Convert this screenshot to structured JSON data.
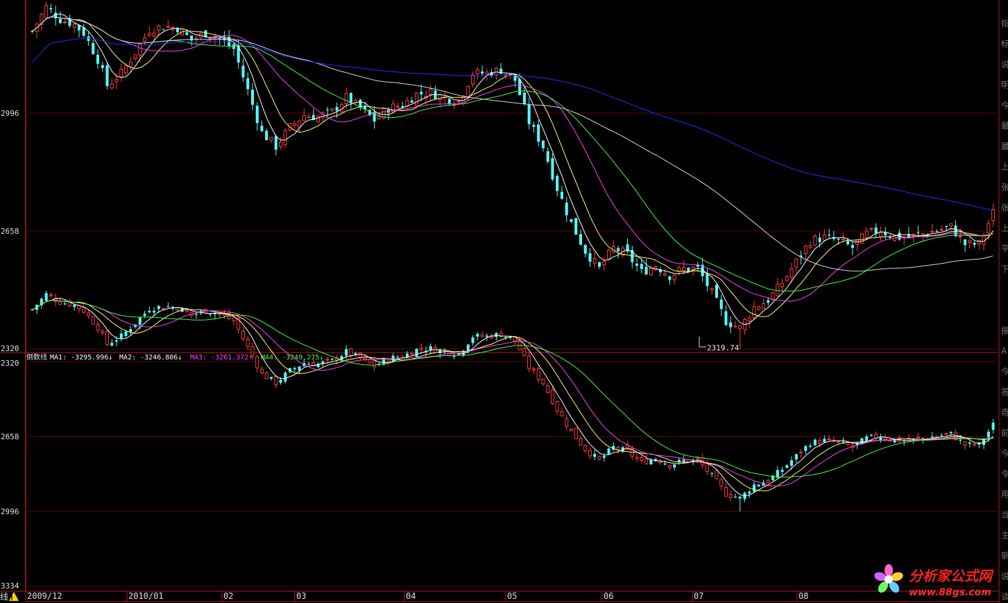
{
  "colors": {
    "background": "#000000",
    "frame": "#c01818",
    "up_candle": "#ff3d3d",
    "down_candle": "#54ffff",
    "ma_white": "#ffffff",
    "ma_yellow": "#ffff80",
    "ma_magenta": "#ff40ff",
    "ma_green": "#40ff40",
    "ma_blue": "#2030ff",
    "ma_gray": "#d8d8d8"
  },
  "top_panel": {
    "y_labels": [
      "2996",
      "2658",
      "2320"
    ],
    "low_marker": "2319.74"
  },
  "bottom_panel": {
    "indicator_name": "倒数线",
    "legend": [
      {
        "name": "MA1",
        "value": "-3295.996",
        "arrow": "↓",
        "color": "#ffffff"
      },
      {
        "name": "MA2",
        "value": "-3246.806",
        "arrow": "↓",
        "color": "#ffffff"
      },
      {
        "name": "MA3",
        "value": "-3261.372",
        "arrow": "↑",
        "color": "#ff40ff"
      },
      {
        "name": "MA4",
        "value": "-3249.275",
        "arrow": "↓",
        "color": "#40ff40"
      }
    ],
    "y_labels": [
      "2320",
      "2658",
      "2996",
      "3334"
    ]
  },
  "x_axis": {
    "corner_label": "线",
    "months": [
      "2009/12",
      "2010/01",
      "02",
      "03",
      "04",
      "05",
      "06",
      "07",
      "08"
    ]
  },
  "right_sidebar": {
    "chars": [
      "指",
      "标",
      "说",
      "明",
      "今",
      "最",
      "最",
      "上",
      "张",
      "张",
      "上",
      "平",
      "下",
      "",
      "",
      "振",
      "A",
      "今",
      "答",
      "奇",
      "前",
      "今",
      "令",
      "用",
      "当",
      "主",
      "钢",
      "说",
      "谈"
    ]
  },
  "watermark": {
    "title": "分析家公式网",
    "url": "www.88gs.com"
  },
  "chart_data": [
    {
      "type": "candlestick",
      "name_panel": "main price",
      "y_ticks": [
        2996,
        2658,
        2320
      ],
      "y_range": [
        2310,
        3330
      ],
      "low_annotation": 2319.74,
      "moving_average_colors": [
        "#ffffff",
        "#ffff80",
        "#ff40ff",
        "#40ff40",
        "#d8d8d8",
        "#2030ff"
      ],
      "close_path": [
        [
          0,
          3230
        ],
        [
          3,
          3300
        ],
        [
          6,
          3265
        ],
        [
          9,
          3250
        ],
        [
          11,
          3225
        ],
        [
          14,
          3150
        ],
        [
          16,
          3075
        ],
        [
          19,
          3110
        ],
        [
          22,
          3170
        ],
        [
          25,
          3235
        ],
        [
          28,
          3245
        ],
        [
          31,
          3240
        ],
        [
          34,
          3205
        ],
        [
          37,
          3225
        ],
        [
          40,
          3210
        ],
        [
          43,
          3180
        ],
        [
          46,
          3060
        ],
        [
          49,
          2940
        ],
        [
          52,
          2900
        ],
        [
          55,
          2955
        ],
        [
          58,
          2990
        ],
        [
          61,
          2985
        ],
        [
          64,
          3000
        ],
        [
          67,
          3040
        ],
        [
          70,
          3010
        ],
        [
          73,
          2975
        ],
        [
          76,
          3010
        ],
        [
          79,
          3020
        ],
        [
          82,
          3050
        ],
        [
          85,
          3055
        ],
        [
          88,
          3040
        ],
        [
          91,
          3030
        ],
        [
          94,
          3110
        ],
        [
          97,
          3110
        ],
        [
          100,
          3120
        ],
        [
          103,
          3090
        ],
        [
          106,
          2970
        ],
        [
          109,
          2900
        ],
        [
          112,
          2780
        ],
        [
          115,
          2680
        ],
        [
          118,
          2600
        ],
        [
          121,
          2550
        ],
        [
          124,
          2610
        ],
        [
          127,
          2590
        ],
        [
          130,
          2540
        ],
        [
          133,
          2560
        ],
        [
          136,
          2530
        ],
        [
          139,
          2550
        ],
        [
          142,
          2550
        ],
        [
          145,
          2480
        ],
        [
          148,
          2400
        ],
        [
          151,
          2380
        ],
        [
          154,
          2440
        ],
        [
          157,
          2460
        ],
        [
          160,
          2510
        ],
        [
          163,
          2570
        ],
        [
          166,
          2630
        ],
        [
          169,
          2640
        ],
        [
          172,
          2630
        ],
        [
          175,
          2610
        ],
        [
          178,
          2650
        ],
        [
          181,
          2660
        ],
        [
          184,
          2640
        ],
        [
          187,
          2640
        ],
        [
          190,
          2650
        ],
        [
          193,
          2660
        ],
        [
          196,
          2670
        ],
        [
          199,
          2620
        ],
        [
          202,
          2620
        ],
        [
          205,
          2710
        ]
      ]
    },
    {
      "type": "candlestick",
      "name_panel": "倒数线 (reciprocal line)",
      "y_ticks": [
        2320,
        2658,
        2996,
        3334
      ],
      "y_axis_inverted": true,
      "y_range": [
        2305,
        3340
      ],
      "series": [
        {
          "name": "MA1",
          "last": -3295.996,
          "trend": "down"
        },
        {
          "name": "MA2",
          "last": -3246.806,
          "trend": "down"
        },
        {
          "name": "MA3",
          "last": -3261.372,
          "trend": "up"
        },
        {
          "name": "MA4",
          "last": -3249.275,
          "trend": "down"
        }
      ]
    }
  ]
}
